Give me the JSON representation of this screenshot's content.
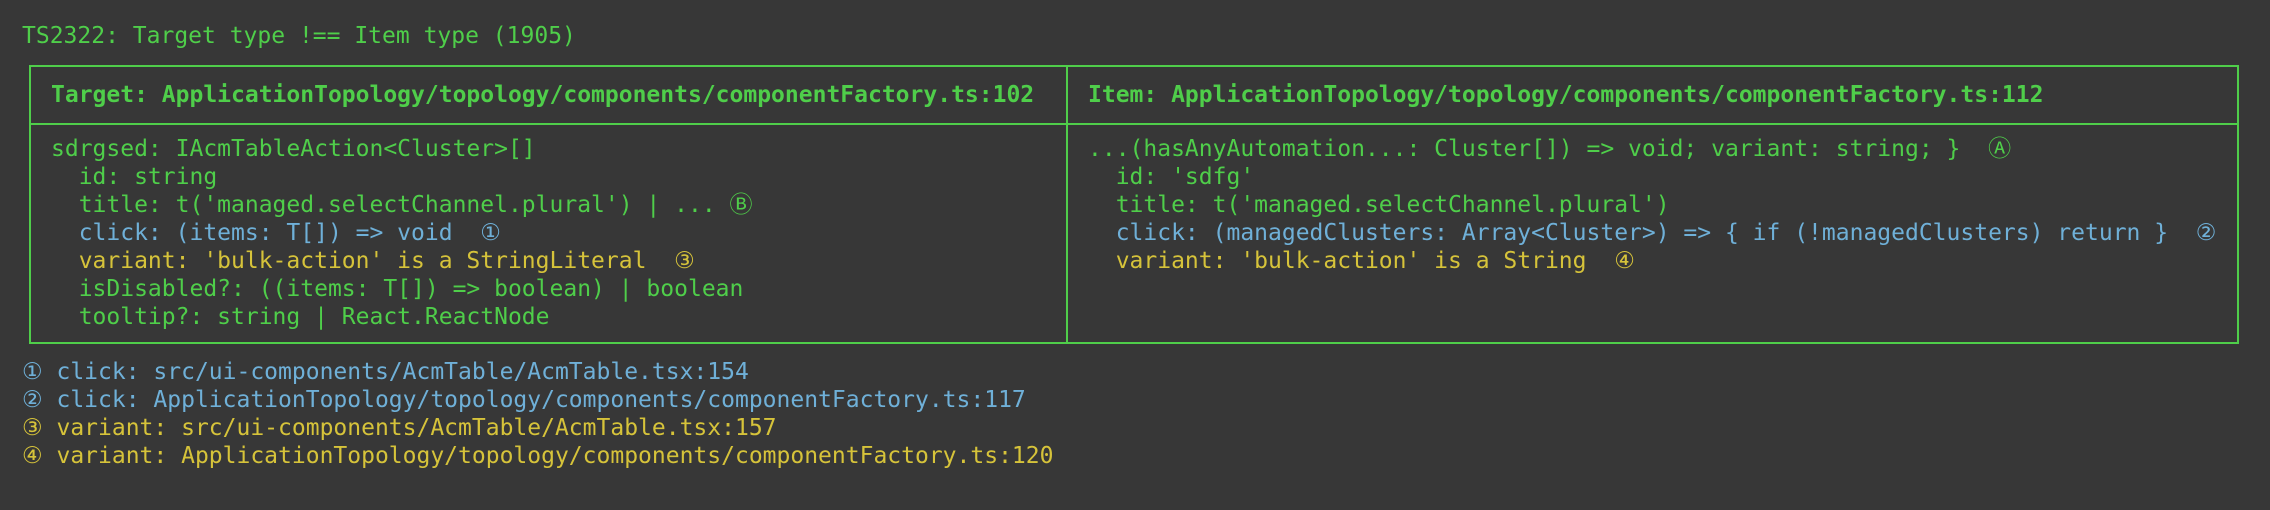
{
  "title": "TS2322: Target type !== Item type (1905)",
  "target": {
    "header": "Target: ApplicationTopology/topology/components/componentFactory.ts:102",
    "lines": [
      {
        "text": "sdrgsed: IAcmTableAction<Cluster>[]",
        "color": "green"
      },
      {
        "text": "  id: string",
        "color": "green"
      },
      {
        "text": "  title: t('managed.selectChannel.plural') | ... Ⓑ",
        "color": "green"
      },
      {
        "text": "  click: (items: T[]) => void  ①",
        "color": "blue"
      },
      {
        "text": "  variant: 'bulk-action' is a StringLiteral  ③",
        "color": "yellow"
      },
      {
        "text": "  isDisabled?: ((items: T[]) => boolean) | boolean",
        "color": "green"
      },
      {
        "text": "  tooltip?: string | React.ReactNode",
        "color": "green"
      }
    ]
  },
  "item": {
    "header": "Item: ApplicationTopology/topology/components/componentFactory.ts:112",
    "lines": [
      {
        "text": "...(hasAnyAutomation...: Cluster[]) => void; variant: string; }  Ⓐ",
        "color": "green"
      },
      {
        "text": "  id: 'sdfg'",
        "color": "green"
      },
      {
        "text": "  title: t('managed.selectChannel.plural')",
        "color": "green"
      },
      {
        "text": "  click: (managedClusters: Array<Cluster>) => { if (!managedClusters) return }  ②",
        "color": "blue"
      },
      {
        "text": "  variant: 'bulk-action' is a String  ④",
        "color": "yellow"
      }
    ]
  },
  "footnotes": [
    {
      "text": "① click: src/ui-components/AcmTable/AcmTable.tsx:154",
      "color": "blue"
    },
    {
      "text": "② click: ApplicationTopology/topology/components/componentFactory.ts:117",
      "color": "blue"
    },
    {
      "text": "③ variant: src/ui-components/AcmTable/AcmTable.tsx:157",
      "color": "yellow"
    },
    {
      "text": "④ variant: ApplicationTopology/topology/components/componentFactory.ts:120",
      "color": "yellow"
    }
  ]
}
